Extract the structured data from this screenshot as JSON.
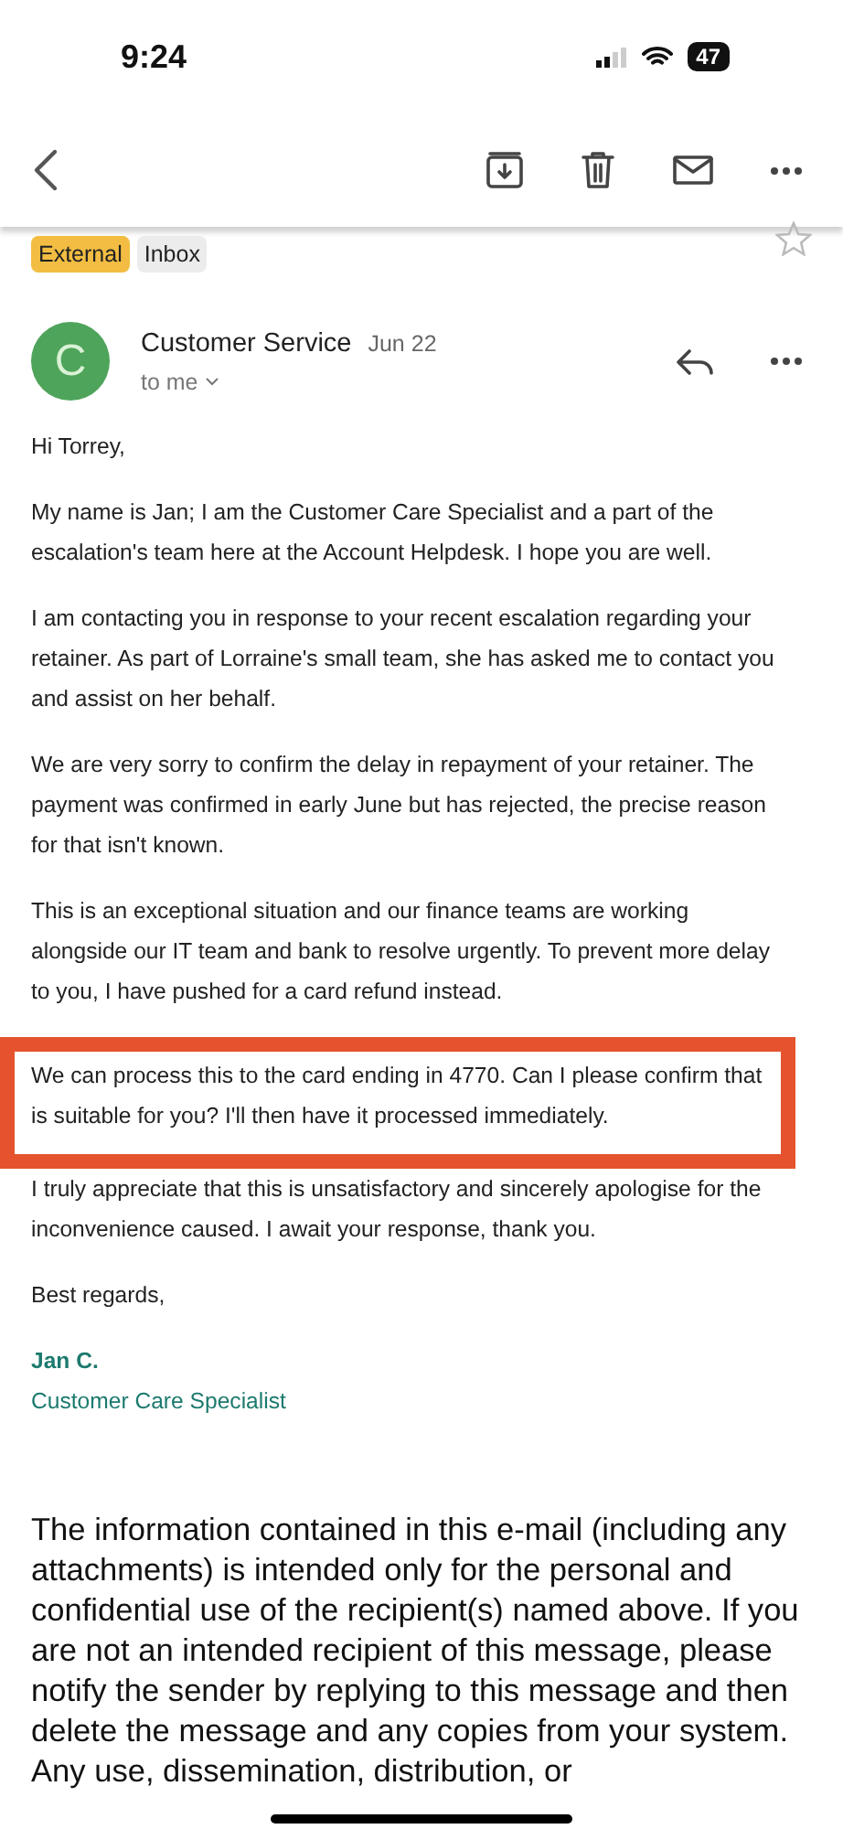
{
  "status_bar": {
    "time": "9:24",
    "battery": "47"
  },
  "labels": [
    {
      "text": "External",
      "kind": "external"
    },
    {
      "text": "Inbox",
      "kind": "folder"
    }
  ],
  "starred": false,
  "message": {
    "avatar": "C",
    "sender": "Customer Service",
    "date": "Jun 22",
    "recipient": "to me",
    "greeting": "Hi Torrey,",
    "paragraphs": [
      {
        "kind": "plain",
        "text": "My name is Jan; I am the Customer Care Specialist and a part of the escalation's team here at the Account Helpdesk. I hope you are well."
      },
      {
        "kind": "plain",
        "text": "I am contacting you in response to your recent escalation regarding your retainer. As part of Lorraine's small team, she has asked me to contact you and assist on her behalf."
      },
      {
        "kind": "plain",
        "text": "We are very sorry to confirm the delay in repayment of your retainer. The payment was confirmed in early June but has rejected, the precise reason for that isn't known."
      },
      {
        "kind": "plain",
        "text": "This is an exceptional situation and our finance teams are working alongside our IT team and bank to resolve urgently. To prevent more delay to you, I have pushed for a card refund instead."
      },
      {
        "kind": "highlighted",
        "text": "We can process this to the card ending in 4770. Can I please confirm that is suitable for you? I'll then have it processed immediately."
      },
      {
        "kind": "plain",
        "text": "I truly appreciate that this is unsatisfactory and sincerely apologise for the inconvenience caused. I await your response, thank you."
      }
    ],
    "closing": "Best regards,",
    "signature_name": "Jan C.",
    "signature_title": "Customer Care Specialist",
    "disclaimer": "The information contained in this e-mail (including any attachments) is intended only for the personal and confidential use of the recipient(s) named above. If you are not an intended recipient of this message, please notify the sender by replying to this message and then delete the message and any copies from your system. Any use, dissemination, distribution, or"
  }
}
